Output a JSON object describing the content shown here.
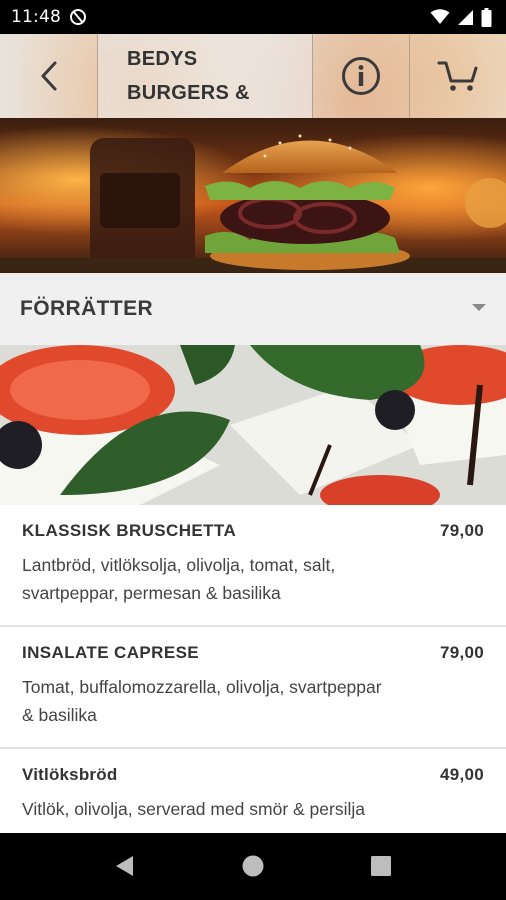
{
  "status_bar": {
    "time": "11:48",
    "icons": [
      "notification-icon",
      "wifi-icon",
      "signal-icon",
      "battery-icon"
    ]
  },
  "header": {
    "title": "BEDYS BURGERS &",
    "back_icon": "back-arrow-icon",
    "info_icon": "info-icon",
    "cart_icon": "cart-icon"
  },
  "category": {
    "title": "FÖRRÄTTER",
    "chevron_icon": "chevron-down-icon"
  },
  "items": [
    {
      "name": "KLASSISK BRUSCHETTA",
      "price": "79,00",
      "description": "Lantbröd, vitlöksolja, olivolja, tomat, salt, svartpeppar, permesan & basilika"
    },
    {
      "name": "INSALATE CAPRESE",
      "price": "79,00",
      "description": "Tomat, buffalomozzarella, olivolja, svartpeppar & basilika"
    },
    {
      "name": "Vitlöksbröd",
      "price": "49,00",
      "description": "Vitlök, olivolja, serverad med smör & persilja"
    }
  ],
  "nav_bar": {
    "icons": [
      "back-triangle-icon",
      "home-circle-icon",
      "recents-square-icon"
    ]
  }
}
